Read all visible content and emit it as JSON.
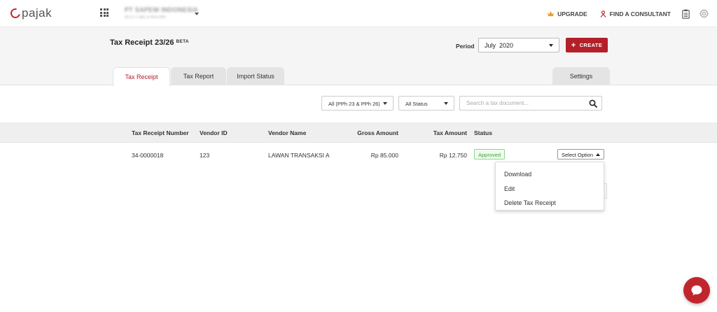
{
  "brand": {
    "logo_text": "pajak"
  },
  "company": {
    "name": "PT SAPEW INDONESIA",
    "npwp": "00.277.582.3-053.000"
  },
  "topbar": {
    "upgrade_label": "UPGRADE",
    "consultant_label": "FIND A CONSULTANT"
  },
  "page": {
    "title": "Tax Receipt 23/26",
    "beta_label": "BETA"
  },
  "period": {
    "label": "Period",
    "value": "July  2020"
  },
  "create_button": {
    "plus": "+",
    "label": "CREATE"
  },
  "tabs": [
    {
      "label": "Tax Receipt",
      "active": true
    },
    {
      "label": "Tax Report",
      "active": false
    },
    {
      "label": "Import Status",
      "active": false
    },
    {
      "label": "Settings",
      "active": false
    }
  ],
  "filters": {
    "type_value": "All (PPh 23 & PPh 26)",
    "status_value": "All Status",
    "search_placeholder": "Search a tax document...",
    "search_value": ""
  },
  "table": {
    "headers": [
      "Tax Receipt Number",
      "Vendor ID",
      "Vendor Name",
      "Gross Amount",
      "Tax Amount",
      "Status"
    ],
    "rows": [
      {
        "receipt_number": "34-0000018",
        "vendor_id": "123",
        "vendor_name": "LAWAN TRANSAKSI A",
        "gross_amount": "Rp 85.000",
        "tax_amount": "Rp 12.750",
        "status": "Approved",
        "action_label": "Select Option"
      }
    ]
  },
  "action_menu": {
    "items": [
      "Download",
      "Edit",
      "Delete Tax Receipt"
    ]
  },
  "colors": {
    "brand_red": "#b3202a",
    "approved_green": "#3aa23a"
  },
  "icons": [
    "apps-grid-icon",
    "crown-icon",
    "person-icon",
    "clipboard-icon",
    "gear-icon",
    "search-icon",
    "chat-icon"
  ]
}
